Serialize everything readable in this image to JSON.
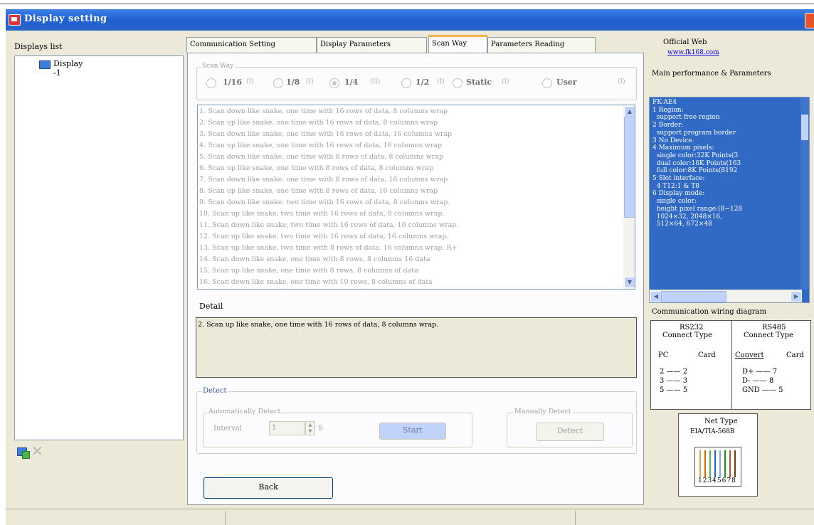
{
  "window": {
    "title": "Display setting"
  },
  "left": {
    "header": "Displays list",
    "tree_item": "Display -1"
  },
  "tabs": [
    "Communication Setting",
    "Display Parameters",
    "Scan Way",
    "Parameters Reading"
  ],
  "scan": {
    "group_title": "Scan Way",
    "options": [
      {
        "label": "1/16",
        "code": "(I)"
      },
      {
        "label": "1/8",
        "code": "(I)"
      },
      {
        "label": "1/4",
        "code": "(II)"
      },
      {
        "label": "1/2",
        "code": "(I)"
      },
      {
        "label": "Static",
        "code": "(I)"
      },
      {
        "label": "User",
        "code": "(I)"
      }
    ],
    "selected": "1/4",
    "list": [
      "1. Scan down like snake, one time with 16 rows of data, 8 columns wrap",
      "2. Scan up like snake, one time with 16 rows of data, 8 columns wrap",
      "3. Scan down like snake, one time with 16 rows of data, 16 columns wrap",
      "4. Scan up like snake, one time with 16 rows of data, 16 columns wrap",
      "5. Scan down like snake, one time with 8 rows of data, 8 columns wrap",
      "6. Scan up like snake, one time with 8 rows of data, 8 columns wrap",
      "7. Scan down like snake, one time with 8 rows of data, 16 columns wrap",
      "8. Scan up like snake, one time with 8 rows of data, 16 columns wrap",
      "9. Scan down like snake, two time with 16 rows of data, 8 columns wrap.",
      "10. Scan up like snake, two time with 16 rows of data, 8 columns wrap.",
      "11. Scan down like snake, two time with 16 rows of data, 16 columns wrap.",
      "12. Scan up like snake, two time with 16 rows of data, 16 columns wrap.",
      "13. Scan up like snake, two time with 8 rows of data, 16 columns wrap. R+",
      "14. Scan down like snake, one time with 8 rows, 8 columns 16 data",
      "15. Scan up like snake, one time with 8 rows, 8 columns of data",
      "16. Scan down like snake, one time with 10 rows, 8 columns of data"
    ],
    "detail_label": "Detail",
    "detail_text": "2. Scan up like snake, one time with 16 rows of data, 8 columns wrap."
  },
  "detect": {
    "group_title": "Detect",
    "auto_title": "Automatically Detect",
    "interval_label": "Interval",
    "interval_value": "1",
    "interval_unit": "S",
    "start_label": "Start",
    "manual_title": "Manually Detect",
    "detect_label": "Detect"
  },
  "back_label": "Back",
  "right": {
    "official_label": "Official Web",
    "official_url": "www.fk168.com",
    "perf_header": "Main performance & Parameters",
    "info_lines": [
      "FK-AE4",
      "1 Region:",
      "  support free region",
      "2 Border:",
      "  support program border",
      "3 No Device.",
      "4 Maximum pixels:",
      "  single color:32K Points(3",
      "  dual color:16K Points(163",
      "  full color:8K Points(8192",
      "5 Slot interface:",
      "  4 T12:1 & T8",
      "6 Display mode:",
      "  single color:",
      "  height pixel range:(8~128",
      "  1024×32, 2048×16,",
      "  512×64, 672×48"
    ],
    "wiring_title": "Communication wiring diagram",
    "rs232": {
      "title": "RS232",
      "subtitle": "Connect Type",
      "col1": "PC",
      "col2": "Card",
      "rows": [
        [
          "2",
          "2"
        ],
        [
          "3",
          "3"
        ],
        [
          "5",
          "5"
        ]
      ]
    },
    "rs485": {
      "title": "RS485",
      "subtitle": "Connect Type",
      "col1": "Convert",
      "col2": "Card",
      "rows": [
        [
          "D+",
          "7"
        ],
        [
          "D-",
          "8"
        ],
        [
          "GND",
          "5"
        ]
      ]
    },
    "net_title": "Net Type",
    "net_subtitle": "EIA/TIA-568B",
    "net_pins": "12345678"
  },
  "colors": {
    "title_blue": "#2a63c9",
    "selection": "#316ac5",
    "dialog_bg": "#ece9d8",
    "tab_active_top": "#f1b54a"
  }
}
